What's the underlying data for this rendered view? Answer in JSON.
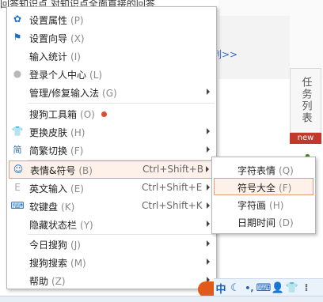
{
  "background": {
    "top_text": "回答知识点 对知识点全面直接的回答",
    "link_text": "列>>",
    "task_tab": "任务列表",
    "new_badge": "new"
  },
  "menu": {
    "items": [
      {
        "label": "设置属性",
        "key": "(P)",
        "icon": "gear-icon"
      },
      {
        "label": "设置向导",
        "key": "(X)",
        "icon": "flag-icon"
      },
      {
        "label": "输入统计",
        "key": "(I)",
        "icon": ""
      },
      {
        "label": "登录个人中心",
        "key": "(L)",
        "icon": "user-icon"
      },
      {
        "label": "管理/修复输入法",
        "key": "(G)",
        "icon": "",
        "submenu": true
      },
      {
        "label": "搜狗工具箱",
        "key": "(O)",
        "icon": "",
        "dot": true
      },
      {
        "label": "更换皮肤",
        "key": "(H)",
        "icon": "shirt-icon",
        "submenu": true
      },
      {
        "label": "简繁切换",
        "key": "(F)",
        "icon": "jian-icon",
        "submenu": true
      },
      {
        "label": "表情&符号",
        "key": "(B)",
        "icon": "smiley-icon",
        "shortcut": "Ctrl+Shift+B",
        "submenu": true,
        "active": true
      },
      {
        "label": "英文输入",
        "key": "(E)",
        "icon": "e-icon",
        "shortcut": "Ctrl+Shift+E",
        "submenu": true
      },
      {
        "label": "软键盘",
        "key": "(K)",
        "icon": "keyboard-icon",
        "shortcut": "Ctrl+Shift+K",
        "submenu": true
      },
      {
        "label": "隐藏状态栏",
        "key": "(Y)",
        "icon": "",
        "submenu": true
      },
      {
        "label": "今日搜狗",
        "key": "(J)",
        "icon": "",
        "submenu": true
      },
      {
        "label": "搜狗搜索",
        "key": "(M)",
        "icon": "",
        "submenu": true
      },
      {
        "label": "帮助",
        "key": "(Z)",
        "icon": "",
        "submenu": true
      }
    ]
  },
  "submenu": {
    "items": [
      {
        "label": "字符表情",
        "key": "(Q)"
      },
      {
        "label": "符号大全",
        "key": "(F)",
        "active": true
      },
      {
        "label": "字符画",
        "key": "(H)"
      },
      {
        "label": "日期时间",
        "key": "(D)"
      }
    ]
  },
  "toolbar": {
    "zh_label": "中",
    "colors": {
      "accent": "#1a5fb4",
      "sogou_orange": "#e05a1b",
      "highlight_bg": "#fdf1ea",
      "highlight_border": "#e89a7c"
    }
  }
}
